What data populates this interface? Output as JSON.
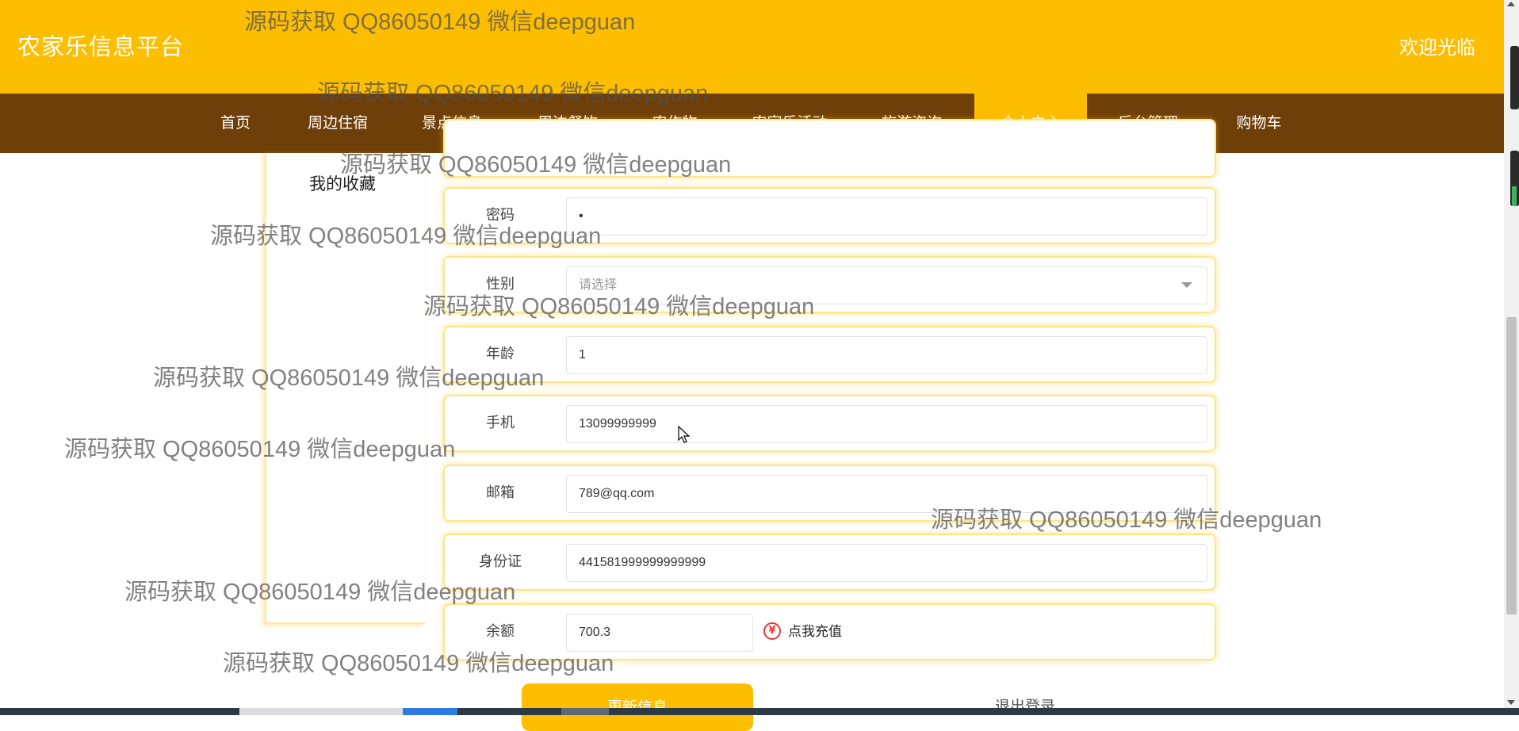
{
  "header": {
    "site_title": "农家乐信息平台",
    "welcome": "欢迎光临"
  },
  "nav": {
    "items": [
      "首页",
      "周边住宿",
      "景点信息",
      "周边餐饮",
      "农作物",
      "农家乐活动",
      "旅游咨询",
      "个人中心",
      "后台管理",
      "购物车"
    ],
    "active": "个人中心"
  },
  "sidebar": {
    "favorites_label": "我的收藏"
  },
  "form": {
    "password": {
      "label": "密码",
      "value": "•"
    },
    "gender": {
      "label": "性别",
      "placeholder": "请选择"
    },
    "age": {
      "label": "年龄",
      "value": "1"
    },
    "phone": {
      "label": "手机",
      "value": "13099999999"
    },
    "email": {
      "label": "邮箱",
      "value": "789@qq.com"
    },
    "id_card": {
      "label": "身份证",
      "value": "441581999999999999"
    },
    "balance": {
      "label": "余额",
      "value": "700.3",
      "recharge_label": "点我充值",
      "recharge_icon": "yen-icon",
      "recharge_symbol": "¥"
    }
  },
  "actions": {
    "update_label": "更新信息",
    "logout_label": "退出登录"
  },
  "watermark": {
    "text": "源码获取 QQ86050149 微信deepguan"
  },
  "colors": {
    "header_bg": "#fdbd00",
    "nav_bg": "#6f3f0a",
    "accent": "#fdbd00"
  }
}
